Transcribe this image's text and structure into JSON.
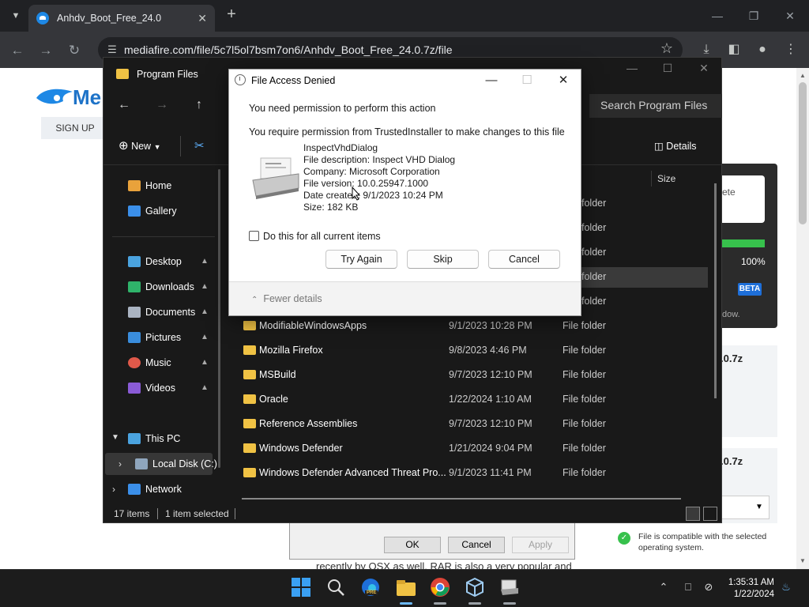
{
  "browser": {
    "tab_title": "Anhdv_Boot_Free_24.0",
    "url": "mediafire.com/file/5c7l5ol7bsm7on6/Anhdv_Boot_Free_24.0.7z/file"
  },
  "site": {
    "logo_text": "Me",
    "signup": "SIGN UP",
    "panel_text_ete": "ete",
    "progress_label": "100%",
    "progress": 1.0,
    "beta": "BETA",
    "dow_text": "dow.",
    "card1_text": ".0.7z",
    "card2_text": ".0.7z",
    "compat_text": "File is compatible with the selected operating system.",
    "props_ok": "OK",
    "props_cancel": "Cancel",
    "props_apply": "Apply",
    "recent_text": "recently by OSX as well. RAR is also a very popular and"
  },
  "explorer": {
    "title": "Program Files",
    "search_placeholder": "Search Program Files",
    "new_label": "New",
    "details_label": "Details",
    "col_size": "Size",
    "nav": [
      {
        "label": "Home"
      },
      {
        "label": "Gallery"
      },
      {
        "label": "Desktop"
      },
      {
        "label": "Downloads"
      },
      {
        "label": "Documents"
      },
      {
        "label": "Pictures"
      },
      {
        "label": "Music"
      },
      {
        "label": "Videos"
      },
      {
        "label": "This PC"
      },
      {
        "label": "Local Disk (C:)"
      },
      {
        "label": "Network"
      }
    ],
    "partial_rows": [
      "folder",
      "folder",
      "folder",
      "folder",
      "folder"
    ],
    "rows": [
      {
        "name": "ModifiableWindowsApps",
        "date": "9/1/2023 10:28 PM",
        "type": "File folder"
      },
      {
        "name": "Mozilla Firefox",
        "date": "9/8/2023 4:46 PM",
        "type": "File folder"
      },
      {
        "name": "MSBuild",
        "date": "9/7/2023 12:10 PM",
        "type": "File folder"
      },
      {
        "name": "Oracle",
        "date": "1/22/2024 1:10 AM",
        "type": "File folder"
      },
      {
        "name": "Reference Assemblies",
        "date": "9/7/2023 12:10 PM",
        "type": "File folder"
      },
      {
        "name": "Windows Defender",
        "date": "1/21/2024 9:04 PM",
        "type": "File folder"
      },
      {
        "name": "Windows Defender Advanced Threat Pro...",
        "date": "9/1/2023 11:41 PM",
        "type": "File folder"
      }
    ],
    "status_items": "17 items",
    "status_selected": "1 item selected"
  },
  "dialog": {
    "title": "File Access Denied",
    "heading": "You need permission to perform this action",
    "message": "You require permission from TrustedInstaller to make changes to this file",
    "file_name": "InspectVhdDialog",
    "file_description": "File description: Inspect VHD Dialog",
    "company": "Company: Microsoft Corporation",
    "version": "File version: 10.0.25947.1000",
    "date_created": "Date created: 9/1/2023 10:24 PM",
    "size": "Size: 182 KB",
    "checkbox_label": "Do this for all current items",
    "try_again": "Try Again",
    "skip": "Skip",
    "cancel": "Cancel",
    "fewer_details": "Fewer details"
  },
  "taskbar": {
    "time": "1:35:31 AM",
    "date": "1/22/2024",
    "edge_badge": "PRE"
  }
}
